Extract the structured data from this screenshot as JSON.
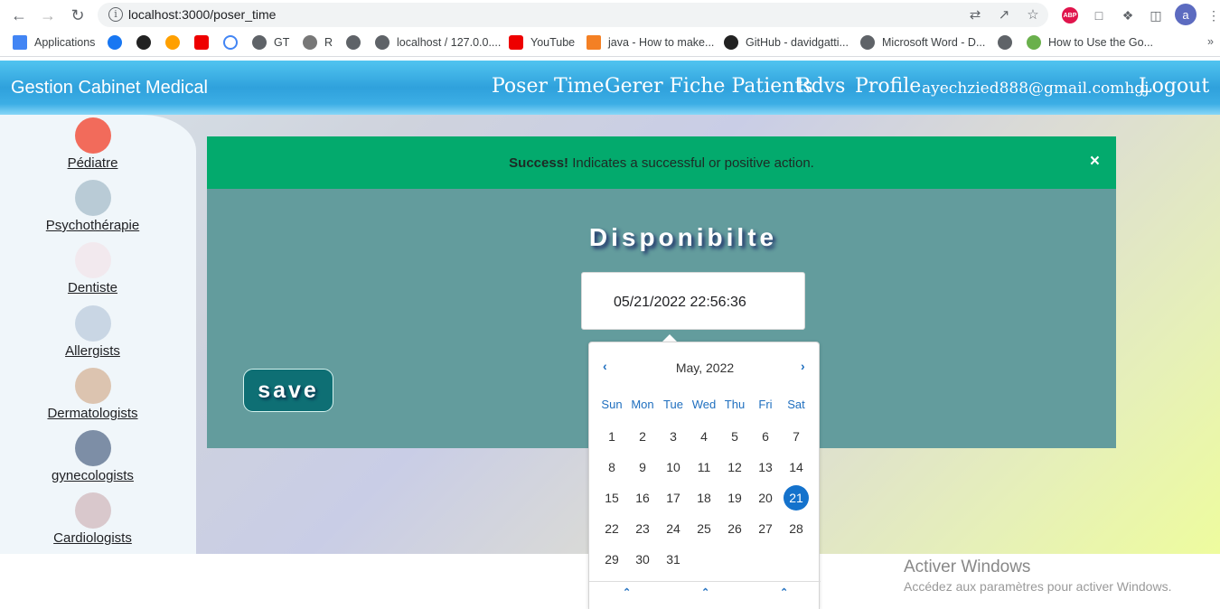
{
  "browser": {
    "url": "localhost:3000/poser_time",
    "avatar_letter": "a",
    "abp_label": "ABP",
    "bookmarks": [
      "Applications",
      "GT",
      "R",
      "localhost / 127.0.0....",
      "YouTube",
      "java - How to make...",
      "GitHub - davidgatti...",
      "Microsoft Word - D...",
      "How to Use the Go..."
    ]
  },
  "header": {
    "brand": "Gestion Cabinet Medical",
    "nav": [
      "Poser Time",
      "Gerer Fiche Patients",
      "Rdvs",
      "Profile"
    ],
    "email": "ayechzied888@gmail.comhgj",
    "logout": "Logout"
  },
  "sidebar": {
    "items": [
      "Pédiatre",
      "Psychothérapie",
      "Dentiste",
      "Allergists",
      "Dermatologists",
      "gynecologists",
      "Cardiologists"
    ]
  },
  "alert": {
    "strong": "Success!",
    "message": " Indicates a successful or positive action.",
    "close": "×"
  },
  "form": {
    "title": "Disponibilte",
    "datetime_value": "05/21/2022 22:56:36",
    "save_label": "save"
  },
  "calendar": {
    "month_label": "May, 2022",
    "weekdays": [
      "Sun",
      "Mon",
      "Tue",
      "Wed",
      "Thu",
      "Fri",
      "Sat"
    ],
    "weeks": [
      [
        "1",
        "2",
        "3",
        "4",
        "5",
        "6",
        "7"
      ],
      [
        "8",
        "9",
        "10",
        "11",
        "12",
        "13",
        "14"
      ],
      [
        "15",
        "16",
        "17",
        "18",
        "19",
        "20",
        "21"
      ],
      [
        "22",
        "23",
        "24",
        "25",
        "26",
        "27",
        "28"
      ],
      [
        "29",
        "30",
        "31"
      ]
    ],
    "selected_day": "21",
    "accent_color": "#1472cc"
  },
  "windows": {
    "line1": "Activer Windows",
    "line2": "Accédez aux paramètres pour activer Windows."
  }
}
